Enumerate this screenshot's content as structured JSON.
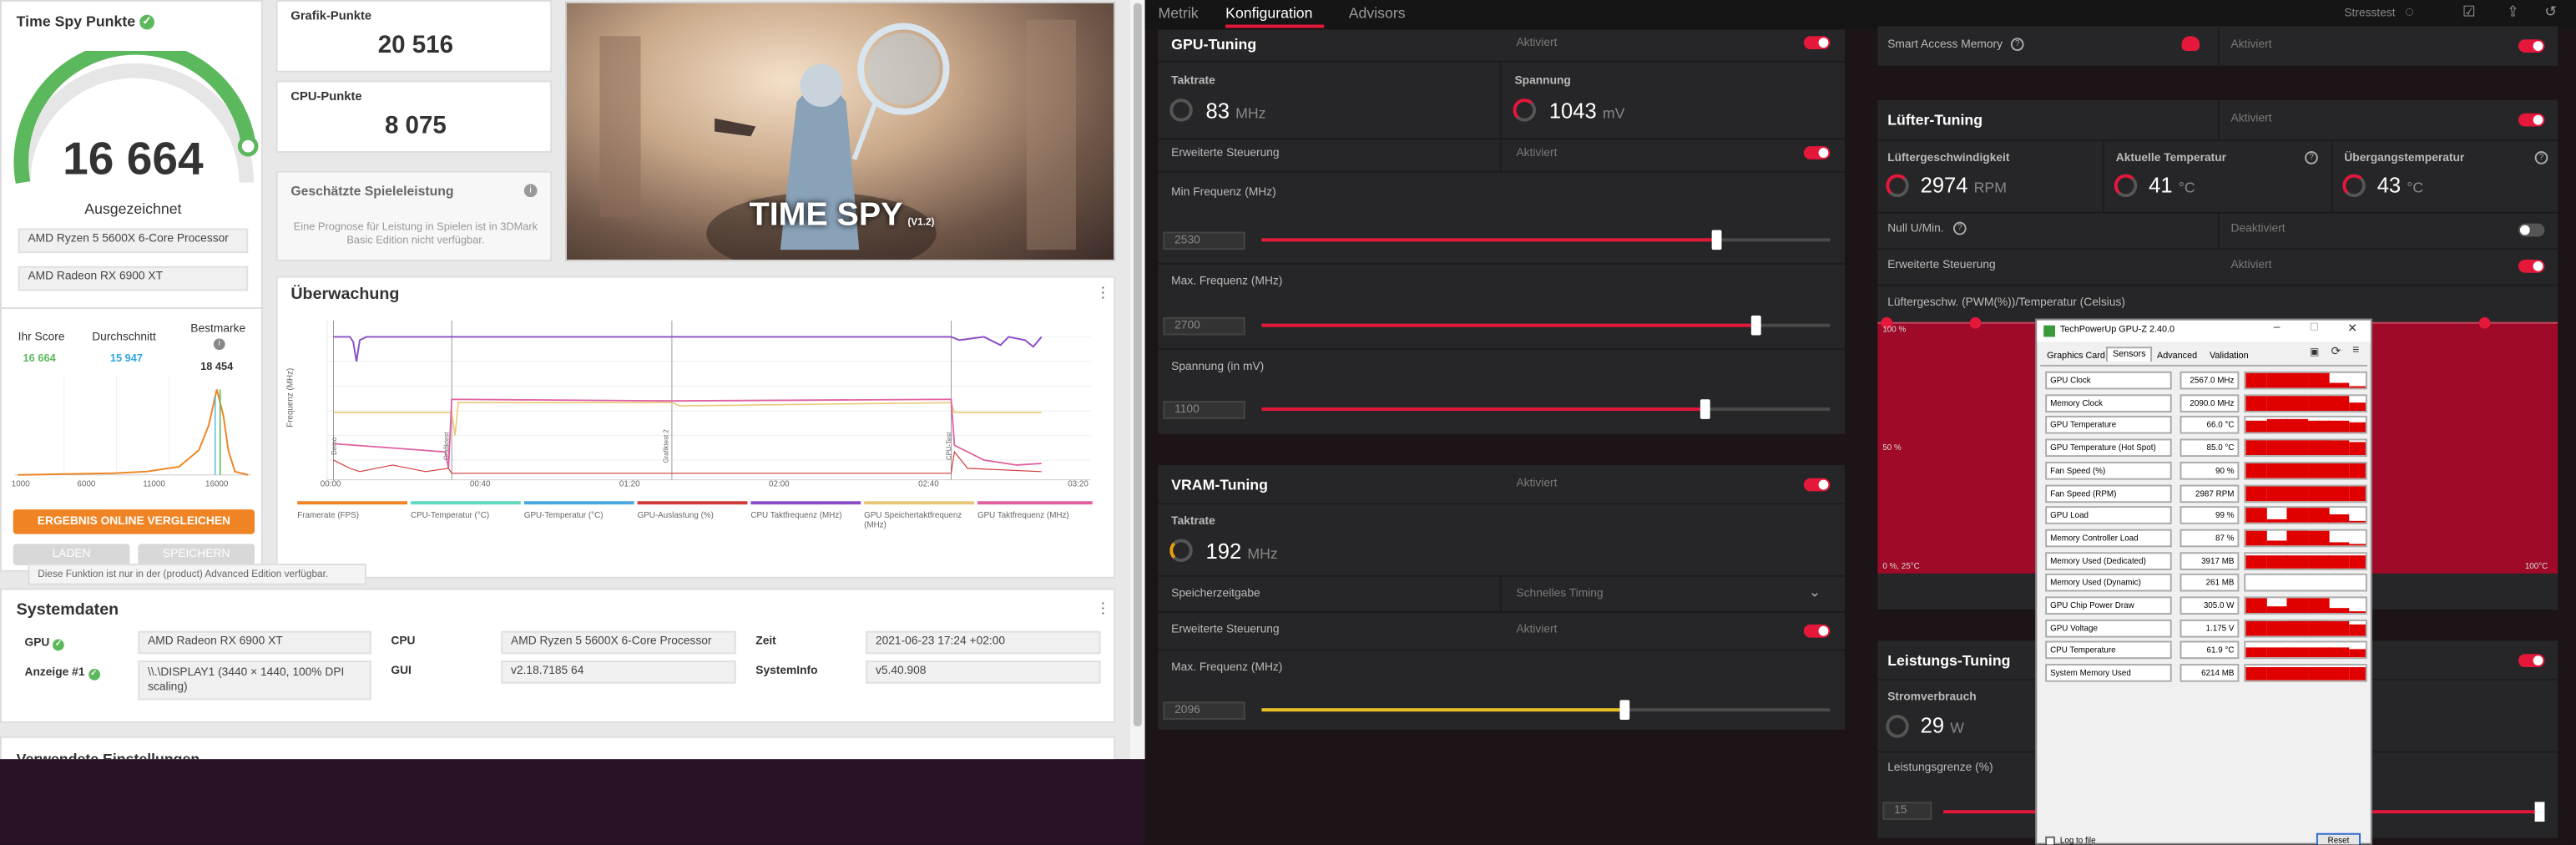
{
  "tdmark": {
    "title": "Time Spy Punkte",
    "score": "16 664",
    "rating": "Ausgezeichnet",
    "cpu_name": "AMD Ryzen 5 5600X 6-Core Processor",
    "gpu_name": "AMD Radeon RX 6900 XT",
    "your_score_label": "Ihr Score",
    "your_score": "16 664",
    "avg_label": "Durchschnitt",
    "avg": "15 947",
    "best_label": "Bestmarke",
    "best": "18 454",
    "dist_ticks": [
      "1000",
      "6000",
      "11000",
      "16000"
    ],
    "compare_button": "ERGEBNIS ONLINE VERGLEICHEN",
    "load_button": "LADEN",
    "save_button": "SPEICHERN",
    "tooltip": "Diese Funktion ist nur in der (product) Advanced Edition verfügbar.",
    "graphics_label": "Grafik-Punkte",
    "graphics_score": "20 516",
    "cpu_label": "CPU-Punkte",
    "cpu_score": "8 075",
    "game_perf_label": "Geschätzte Spieleleistung",
    "game_perf_note": "Eine Prognose für Leistung in Spielen ist in 3DMark Basic Edition nicht verfügbar.",
    "banner_title": "TIME SPY",
    "banner_version": "(V1.2)",
    "monitor_title": "Überwachung",
    "monitor_y_axis": "Frequenz (MHz)",
    "monitor_x_ticks": [
      "00:00",
      "00:40",
      "01:20",
      "02:00",
      "02:40",
      "03:20"
    ],
    "monitor_markers": [
      "Demo",
      "Grafiktest",
      "Grafiktest 2",
      "CPU-Test"
    ],
    "legend": [
      {
        "label": "Framerate (FPS)",
        "color": "#f08424"
      },
      {
        "label": "CPU-Temperatur (°C)",
        "color": "#5fd9c0"
      },
      {
        "label": "GPU-Temperatur (°C)",
        "color": "#4aa8e0"
      },
      {
        "label": "GPU-Auslastung (%)",
        "color": "#d23a3a"
      },
      {
        "label": "CPU Taktfrequenz (MHz)",
        "color": "#8a4ec8"
      },
      {
        "label": "GPU Speichertaktfrequenz (MHz)",
        "color": "#e8c878"
      },
      {
        "label": "GPU Taktfrequenz (MHz)",
        "color": "#e060a0"
      }
    ],
    "sys_title": "Systemdaten",
    "sys": {
      "gpu_label": "GPU",
      "gpu_value": "AMD Radeon RX 6900 XT",
      "display_label": "Anzeige #1",
      "display_value": "\\\\.\\DISPLAY1 (3440 × 1440, 100% DPI scaling)",
      "cpu_label": "CPU",
      "cpu_value": "AMD Ryzen 5 5600X 6-Core Processor",
      "gui_label": "GUI",
      "gui_value": "v2.18.7185 64",
      "time_label": "Zeit",
      "time_value": "2021-06-23 17:24 +02:00",
      "sysinfo_label": "SystemInfo",
      "sysinfo_value": "v5.40.908"
    },
    "next_section": "Verwendete Einstellungen"
  },
  "amd": {
    "tabs": [
      "Metrik",
      "Konfiguration",
      "Advisors"
    ],
    "active_tab": "Konfiguration",
    "stress_label": "Stresstest",
    "gpu_tuning": {
      "title": "GPU-Tuning",
      "status": "Aktiviert",
      "clock_label": "Taktrate",
      "clock_value": "83",
      "clock_unit": "MHz",
      "voltage_label": "Spannung",
      "voltage_value": "1043",
      "voltage_unit": "mV",
      "adv_label": "Erweiterte Steuerung",
      "adv_status": "Aktiviert",
      "min_freq_label": "Min Frequenz (MHz)",
      "min_freq_value": "2530",
      "min_freq_fraction": 0.8,
      "max_freq_label": "Max. Frequenz (MHz)",
      "max_freq_value": "2700",
      "max_freq_fraction": 0.87,
      "volt_set_label": "Spannung (in mV)",
      "volt_set_value": "1100",
      "volt_set_fraction": 0.78
    },
    "vram_tuning": {
      "title": "VRAM-Tuning",
      "status": "Aktiviert",
      "clock_label": "Taktrate",
      "clock_value": "192",
      "clock_unit": "MHz",
      "timing_label": "Speicherzeitgabe",
      "timing_value": "Schnelles Timing",
      "adv_label": "Erweiterte Steuerung",
      "adv_status": "Aktiviert",
      "max_freq_label": "Max. Frequenz (MHz)",
      "max_freq_value": "2096",
      "max_freq_fraction": 0.64
    },
    "sam": {
      "label": "Smart Access Memory",
      "status": "Aktiviert"
    },
    "fan_tuning": {
      "title": "Lüfter-Tuning",
      "status": "Aktiviert",
      "speed_label": "Lüftergeschwindigkeit",
      "speed_value": "2974",
      "speed_unit": "RPM",
      "temp_label": "Aktuelle Temperatur",
      "temp_value": "41",
      "temp_unit": "°C",
      "junction_label": "Übergangstemperatur",
      "junction_value": "43",
      "junction_unit": "°C",
      "zero_rpm_label": "Null U/Min.",
      "zero_rpm_status": "Deaktiviert",
      "adv_label": "Erweiterte Steuerung",
      "adv_status": "Aktiviert",
      "curve_label": "Lüftergeschw. (PWM(%))/Temperatur (Celsius)",
      "curve_y_top": "100 %",
      "curve_y_mid": "50 %",
      "curve_x_left": "0 %, 25°C",
      "curve_x_right": "100°C"
    },
    "power_tuning": {
      "title": "Leistungs-Tuning",
      "draw_label": "Stromverbrauch",
      "draw_value": "29",
      "draw_unit": "W",
      "limit_label": "Leistungsgrenze (%)",
      "limit_value": "15"
    }
  },
  "gpuz": {
    "title": "TechPowerUp GPU-Z 2.40.0",
    "tabs": [
      "Graphics Card",
      "Sensors",
      "Advanced",
      "Validation"
    ],
    "active_tab": "Sensors",
    "sensors": [
      {
        "name": "GPU Clock",
        "value": "2567.0 MHz"
      },
      {
        "name": "Memory Clock",
        "value": "2090.0 MHz"
      },
      {
        "name": "GPU Temperature",
        "value": "66.0 °C"
      },
      {
        "name": "GPU Temperature (Hot Spot)",
        "value": "85.0 °C"
      },
      {
        "name": "Fan Speed (%)",
        "value": "90 %"
      },
      {
        "name": "Fan Speed (RPM)",
        "value": "2987 RPM"
      },
      {
        "name": "GPU Load",
        "value": "99 %"
      },
      {
        "name": "Memory Controller Load",
        "value": "87 %"
      },
      {
        "name": "Memory Used (Dedicated)",
        "value": "3917 MB"
      },
      {
        "name": "Memory Used (Dynamic)",
        "value": "261 MB"
      },
      {
        "name": "GPU Chip Power Draw",
        "value": "305.0 W"
      },
      {
        "name": "GPU Voltage",
        "value": "1.175 V"
      },
      {
        "name": "CPU Temperature",
        "value": "61.9 °C"
      },
      {
        "name": "System Memory Used",
        "value": "6214 MB"
      }
    ],
    "log_label": "Log to file",
    "reset_label": "Reset"
  }
}
